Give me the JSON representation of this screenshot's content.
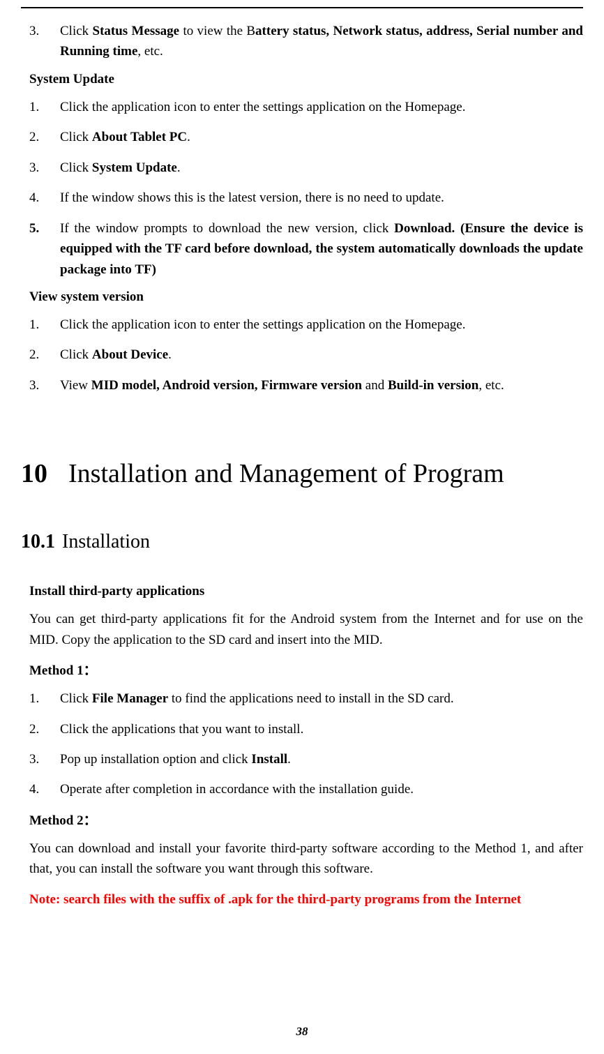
{
  "top_item3": {
    "num": "3.",
    "t1": "Click ",
    "b1": "Status Message",
    "t2": " to view the B",
    "b2": "attery status, Network status, address, Serial number and Running time",
    "t3": ", etc."
  },
  "sysupdate": {
    "heading": "System Update",
    "i1": {
      "num": "1.",
      "text": "Click the application icon to enter the settings application on the Homepage."
    },
    "i2": {
      "num": "2.",
      "t1": "Click ",
      "b1": "About Tablet PC",
      "t2": "."
    },
    "i3": {
      "num": "3.",
      "t1": "Click ",
      "b1": "System Update",
      "t2": "."
    },
    "i4": {
      "num": "4.",
      "text": "If the window shows this is the latest version, there is no need to update."
    },
    "i5": {
      "num": "5.",
      "t1": "If the window prompts to download the new version, click ",
      "b1": "Download. (Ensure the device is equipped with the TF card before download, the system automatically downloads the update package into TF)"
    }
  },
  "viewsys": {
    "heading": "View system version",
    "i1": {
      "num": "1.",
      "text": "Click the application icon to enter the settings application on the Homepage."
    },
    "i2": {
      "num": "2.",
      "t1": "Click ",
      "b1": "About Device",
      "t2": "."
    },
    "i3": {
      "num": "3.",
      "t1": "View ",
      "b1": "MID model, Android version, Firmware version",
      "t2": " and ",
      "b2": "Build-in version",
      "t3": ", etc."
    }
  },
  "chapter": {
    "num": "10",
    "title": "Installation and Management of Program"
  },
  "section": {
    "num": "10.1",
    "title": "Installation"
  },
  "install": {
    "heading": "Install third-party applications",
    "intro": "You can get third-party applications fit for the Android system from the Internet and for use on the MID. Copy the application to the SD card and insert into the MID.",
    "m1_label": "Method 1：",
    "m1_i1": {
      "num": "1.",
      "t1": "Click ",
      "b1": "File Manager",
      "t2": " to find the applications need to install in the SD card."
    },
    "m1_i2": {
      "num": "2.",
      "text": "Click the applications that you want to install."
    },
    "m1_i3": {
      "num": "3.",
      "t1": "Pop up installation option and click ",
      "b1": "Install",
      "t2": "."
    },
    "m1_i4": {
      "num": "4.",
      "text": "Operate after completion in accordance with the installation guide."
    },
    "m2_label": "Method 2：",
    "m2_text": "You can download and install your favorite third-party software according to the Method 1, and after that, you can install the software you want through this software.",
    "note": "Note: search files with the suffix of .apk for the third-party programs from the Internet"
  },
  "pagenum": "38"
}
